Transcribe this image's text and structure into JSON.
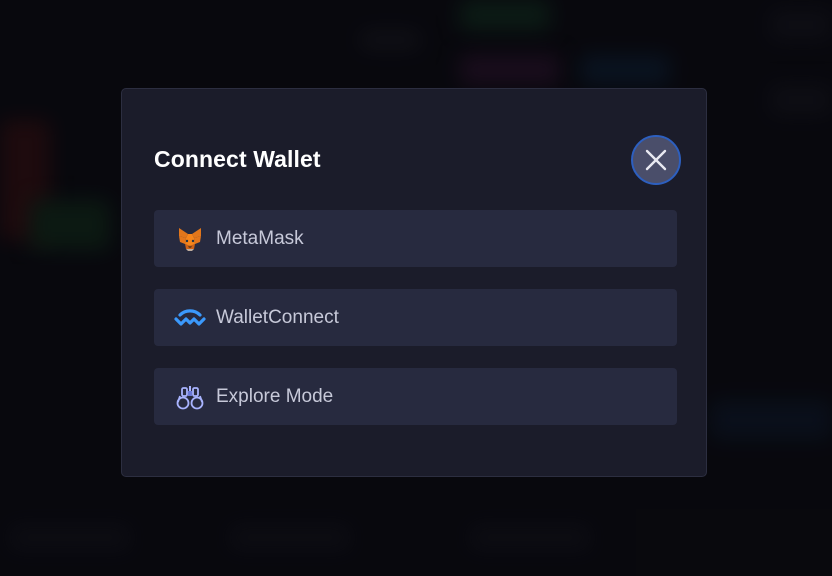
{
  "modal": {
    "title": "Connect Wallet",
    "close_icon": "close-icon"
  },
  "wallets": [
    {
      "label": "MetaMask",
      "icon": "metamask-fox-icon"
    },
    {
      "label": "WalletConnect",
      "icon": "walletconnect-icon"
    },
    {
      "label": "Explore Mode",
      "icon": "binoculars-icon"
    }
  ],
  "colors": {
    "modal_bg": "#1b1c2a",
    "option_bg": "#272a3f",
    "close_ring": "#2d5fbf",
    "walletconnect_blue": "#3b99fc"
  }
}
